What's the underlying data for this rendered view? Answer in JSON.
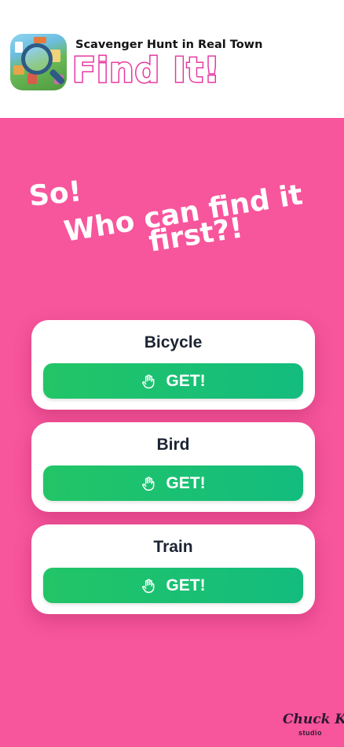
{
  "header": {
    "subtitle": "Scavenger Hunt in Real Town",
    "title": "Find It!",
    "icon": "app-icon-town-magnifier"
  },
  "slogan": {
    "line1": "So!",
    "line2": "Who can find it",
    "line3": "first?!"
  },
  "cards": [
    {
      "name": "Bicycle",
      "button_label": "GET!",
      "button_icon": "hand-icon"
    },
    {
      "name": "Bird",
      "button_label": "GET!",
      "button_icon": "hand-icon"
    },
    {
      "name": "Train",
      "button_label": "GET!",
      "button_icon": "hand-icon"
    }
  ],
  "footer": {
    "logo_text": "Chuck K",
    "logo_subtext": "studio"
  },
  "colors": {
    "background": "#f7559c",
    "button_start": "#22c566",
    "button_end": "#13bc7e",
    "title_outline": "#e63aa0"
  }
}
